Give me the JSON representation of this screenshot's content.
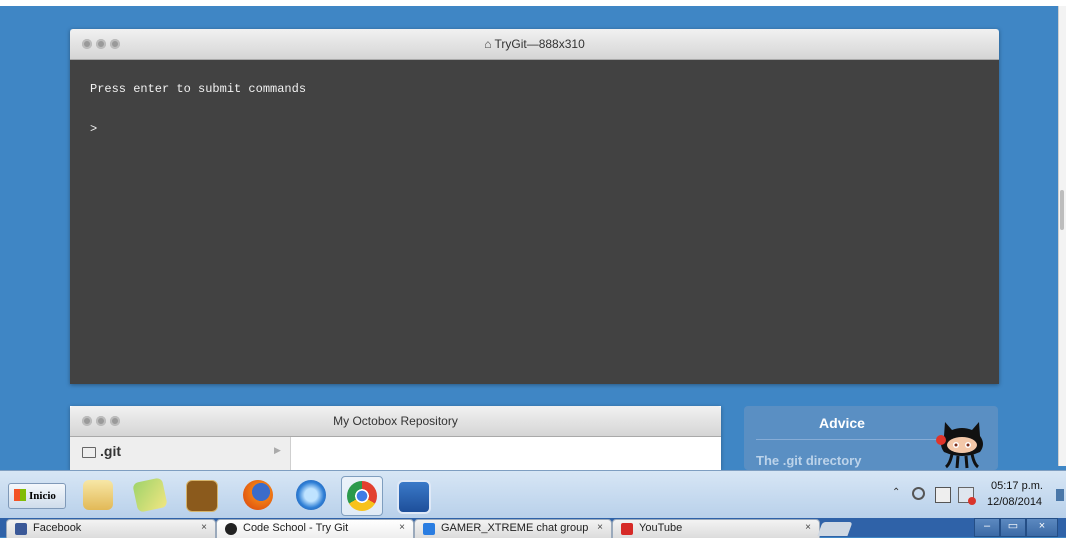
{
  "terminal": {
    "title": "TryGit—888x310",
    "message": "Press enter to submit commands",
    "prompt": ">"
  },
  "repo": {
    "title": "My Octobox Repository",
    "folder": ".git"
  },
  "advice": {
    "title": "Advice",
    "subtitle": "The .git directory"
  },
  "taskbar": {
    "start_label": "Inicio",
    "clock_time": "05:17 p.m.",
    "clock_date": "12/08/2014"
  },
  "tabs": [
    {
      "label": "Facebook",
      "close": "×"
    },
    {
      "label": "Code School - Try Git",
      "close": "×"
    },
    {
      "label": "GAMER_XTREME chat group",
      "close": "×"
    },
    {
      "label": "YouTube",
      "close": "×"
    }
  ],
  "window_controls": {
    "minimize": "–",
    "restore": "▭",
    "close": "×"
  }
}
